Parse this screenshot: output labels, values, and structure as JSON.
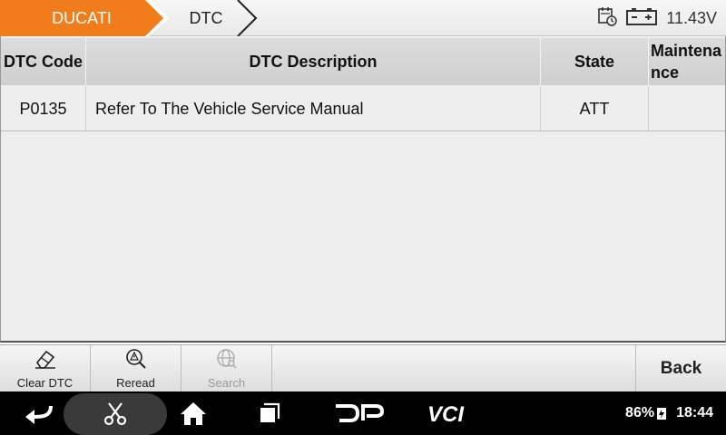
{
  "breadcrumb": {
    "items": [
      "DUCATI",
      "DTC"
    ]
  },
  "status": {
    "voltage": "11.43V",
    "icons": [
      "calendar-clock-icon",
      "battery-icon"
    ]
  },
  "table": {
    "columns": [
      "DTC Code",
      "DTC Description",
      "State",
      "Maintenance"
    ],
    "rows": [
      {
        "code": "P0135",
        "description": "Refer To The Vehicle Service Manual",
        "state": "ATT",
        "maintenance": ""
      }
    ]
  },
  "toolbar": {
    "buttons": [
      {
        "label": "Clear DTC",
        "icon": "eraser-icon",
        "enabled": true
      },
      {
        "label": "Reread",
        "icon": "magnifier-warning-icon",
        "enabled": true
      },
      {
        "label": "Search",
        "icon": "globe-search-icon",
        "enabled": false
      }
    ],
    "back_label": "Back"
  },
  "system": {
    "battery": "86%",
    "time": "18:44",
    "nav_icons": [
      "back-arrow-icon",
      "scissors-icon",
      "home-icon",
      "recents-icon",
      "dp-logo",
      "vci-logo"
    ],
    "nav_labels": {
      "dp": "DP",
      "vci": "VCI"
    }
  },
  "colors": {
    "accent": "#f07c1c",
    "nav_bg": "#000000"
  }
}
